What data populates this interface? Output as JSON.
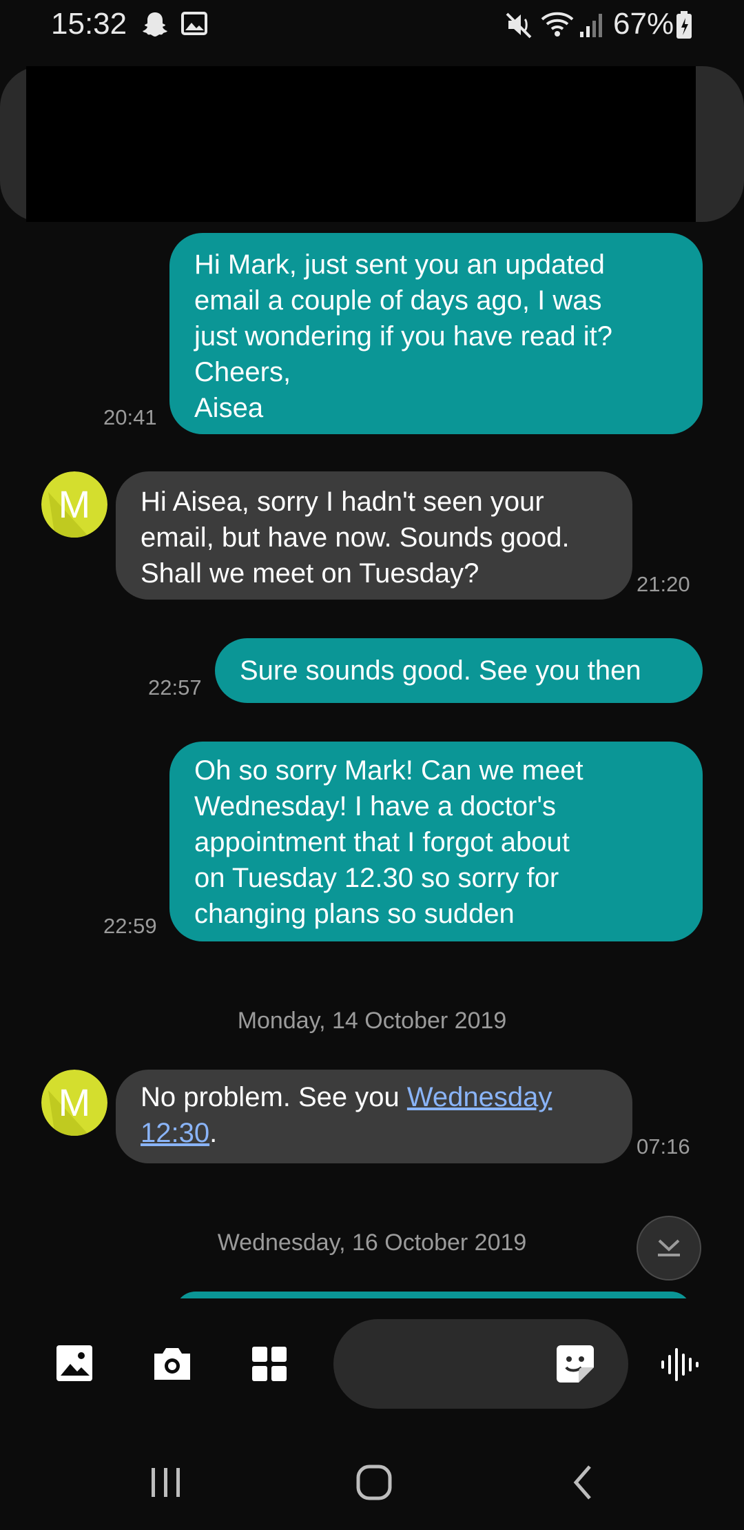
{
  "status_bar": {
    "time": "15:32",
    "battery_text": "67%",
    "icons": [
      "snapchat-icon",
      "gallery-notification-icon",
      "mute-icon",
      "wifi-icon",
      "signal-icon",
      "battery-icon"
    ]
  },
  "conversation": {
    "messages": [
      {
        "direction": "outgoing",
        "text": "Hi Mark, just sent you an updated\nemail a couple of days ago, I was\njust wondering if you have read it?\nCheers,\nAisea",
        "time": "20:41"
      },
      {
        "direction": "incoming",
        "avatar_letter": "M",
        "text": "Hi Aisea, sorry I hadn't seen your\nemail, but have now. Sounds good.\nShall we meet on Tuesday?",
        "time": "21:20"
      },
      {
        "direction": "outgoing",
        "text": "Sure sounds good. See you then",
        "time": "22:57"
      },
      {
        "direction": "outgoing",
        "text": "Oh so sorry Mark! Can we meet\nWednesday! I have a doctor's\nappointment that I forgot about\non Tuesday 12.30 so sorry for\nchanging plans so sudden",
        "time": "22:59"
      },
      {
        "direction": "incoming",
        "avatar_letter": "M",
        "text_before": "No problem. See you ",
        "link_text_line1": "Wednesday",
        "link_text_line2": "12:30",
        "text_after": ".",
        "time": "07:16"
      }
    ],
    "date_separators": [
      "Monday, 14 October 2019",
      "Wednesday, 16 October 2019"
    ]
  },
  "composer": {
    "tools": [
      "gallery-icon",
      "camera-icon",
      "apps-grid-icon",
      "sticker-icon",
      "voice-waveform-icon"
    ]
  },
  "colors": {
    "outgoing_bubble": "#0b9696",
    "incoming_bubble": "#3c3c3c",
    "avatar": "#d4de2e",
    "link": "#8ab4f8",
    "background": "#0c0c0c"
  },
  "navigation": [
    "recent-apps-icon",
    "home-icon",
    "back-icon"
  ]
}
